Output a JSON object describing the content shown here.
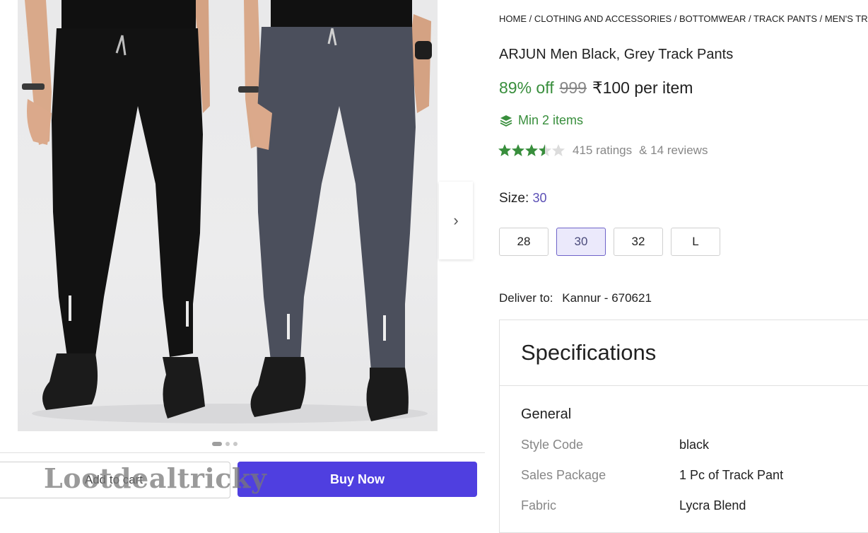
{
  "gallery": {
    "image_alt": "Two men wearing black and grey track pants",
    "next_arrow": "›",
    "dots": 3
  },
  "actions": {
    "add_to_cart": "Add to cart",
    "buy_now": "Buy Now"
  },
  "watermark": "Lootdealtricky",
  "product": {
    "breadcrumb": "HOME / CLOTHING AND ACCESSORIES / BOTTOMWEAR / TRACK PANTS / MEN'S TRACK PANTS",
    "title": "ARJUN Men Black, Grey Track Pants",
    "discount": "89% off",
    "mrp": "999",
    "price": "₹100 per item",
    "min_items": "Min 2 items",
    "rating_value": 3.5,
    "ratings": "415 ratings",
    "reviews": "& 14 reviews",
    "size_label": "Size:",
    "selected_size": "30",
    "sizes": [
      "28",
      "30",
      "32",
      "L"
    ],
    "deliver_label": "Deliver to:",
    "deliver_location": "Kannur - 670621"
  },
  "specs": {
    "title": "Specifications",
    "section": "General",
    "rows": [
      {
        "key": "Style Code",
        "value": "black"
      },
      {
        "key": "Sales Package",
        "value": "1 Pc of Track Pant"
      },
      {
        "key": "Fabric",
        "value": "Lycra Blend"
      }
    ]
  },
  "colors": {
    "accent": "#4f3fe0",
    "green": "#388e3c",
    "selected_size_bg": "#ebe9fb"
  }
}
